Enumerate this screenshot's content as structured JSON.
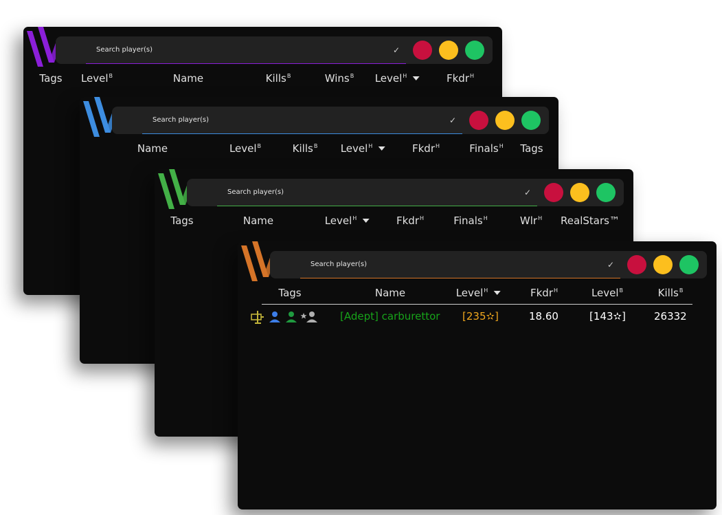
{
  "search": {
    "placeholder": "Search player(s)"
  },
  "windows": [
    {
      "accent": "#8b1fd9",
      "columns": [
        "Tags",
        "Level",
        "Name",
        "Kills",
        "Wins",
        "Level",
        "Fkdr"
      ],
      "sups": [
        "",
        "B",
        "",
        "B",
        "B",
        "H",
        "H"
      ]
    },
    {
      "accent": "#3d8de0",
      "columns": [
        "Name",
        "Level",
        "Kills",
        "Level",
        "Fkdr",
        "Finals",
        "Tags"
      ],
      "sups": [
        "",
        "B",
        "B",
        "H",
        "H",
        "H",
        ""
      ]
    },
    {
      "accent": "#43b047",
      "columns": [
        "Tags",
        "Name",
        "Level",
        "Fkdr",
        "Finals",
        "Wlr",
        "RealStars™"
      ],
      "sups": [
        "",
        "",
        "H",
        "H",
        "H",
        "H",
        ""
      ]
    },
    {
      "accent": "#d57428",
      "columns": [
        "Tags",
        "Name",
        "Level",
        "Fkdr",
        "Level",
        "Kills"
      ],
      "sups": [
        "",
        "",
        "H",
        "H",
        "B",
        "B"
      ],
      "rows": [
        {
          "tag_icons": [
            "sword-stand-icon",
            "user-blue-icon",
            "user-green-icon",
            "star-user-icon"
          ],
          "name": "[Adept] carburettor",
          "level_h": "[235✫]",
          "fkdr": "18.60",
          "level_b": "[143✫]",
          "kills": "26332"
        }
      ]
    }
  ],
  "colors": {
    "name_green": "#17a31a",
    "level_gold": "#f0a71d",
    "close_red": "#c8103e",
    "minimize_yellow": "#fcbf1e",
    "maximize_green": "#1ec463"
  },
  "icons": {
    "check": "✓",
    "sort": "caret-down-icon"
  }
}
